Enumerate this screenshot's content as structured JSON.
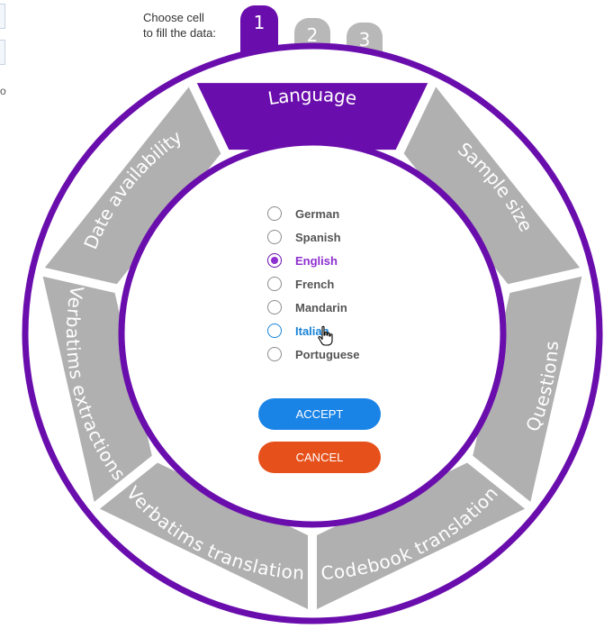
{
  "hint": {
    "line1": "Choose cell",
    "line2": "to fill the data:"
  },
  "left_fragment": {
    "text": "o"
  },
  "tabs": [
    {
      "label": "1",
      "active": true
    },
    {
      "label": "2",
      "active": false
    },
    {
      "label": "3",
      "active": false
    }
  ],
  "segments": [
    {
      "id": "language",
      "label": "Language",
      "active": true
    },
    {
      "id": "sample-size",
      "label": "Sample size",
      "active": false
    },
    {
      "id": "questions",
      "label": "Questions",
      "active": false
    },
    {
      "id": "codebook-translation",
      "label": "Codebook translation",
      "active": false
    },
    {
      "id": "verbatims-translation",
      "label": "Verbatims translation",
      "active": false
    },
    {
      "id": "verbatims-extractions",
      "label": "Verbatims extractions",
      "active": false
    },
    {
      "id": "date-availability",
      "label": "Date availability",
      "active": false
    }
  ],
  "options": [
    {
      "label": "German",
      "state": "normal"
    },
    {
      "label": "Spanish",
      "state": "normal"
    },
    {
      "label": "English",
      "state": "selected"
    },
    {
      "label": "French",
      "state": "normal"
    },
    {
      "label": "Mandarin",
      "state": "normal"
    },
    {
      "label": "Italian",
      "state": "hover"
    },
    {
      "label": "Portuguese",
      "state": "normal"
    }
  ],
  "buttons": {
    "accept": "ACCEPT",
    "cancel": "CANCEL"
  },
  "colors": {
    "primary": "#6a0dad",
    "segment_gray": "#b0b0b0",
    "tab_gray": "#b8b8b8",
    "selected_text": "#8e2fd0",
    "hover_blue": "#1a84d8",
    "accept": "#1a84e6",
    "cancel": "#e6501a"
  }
}
